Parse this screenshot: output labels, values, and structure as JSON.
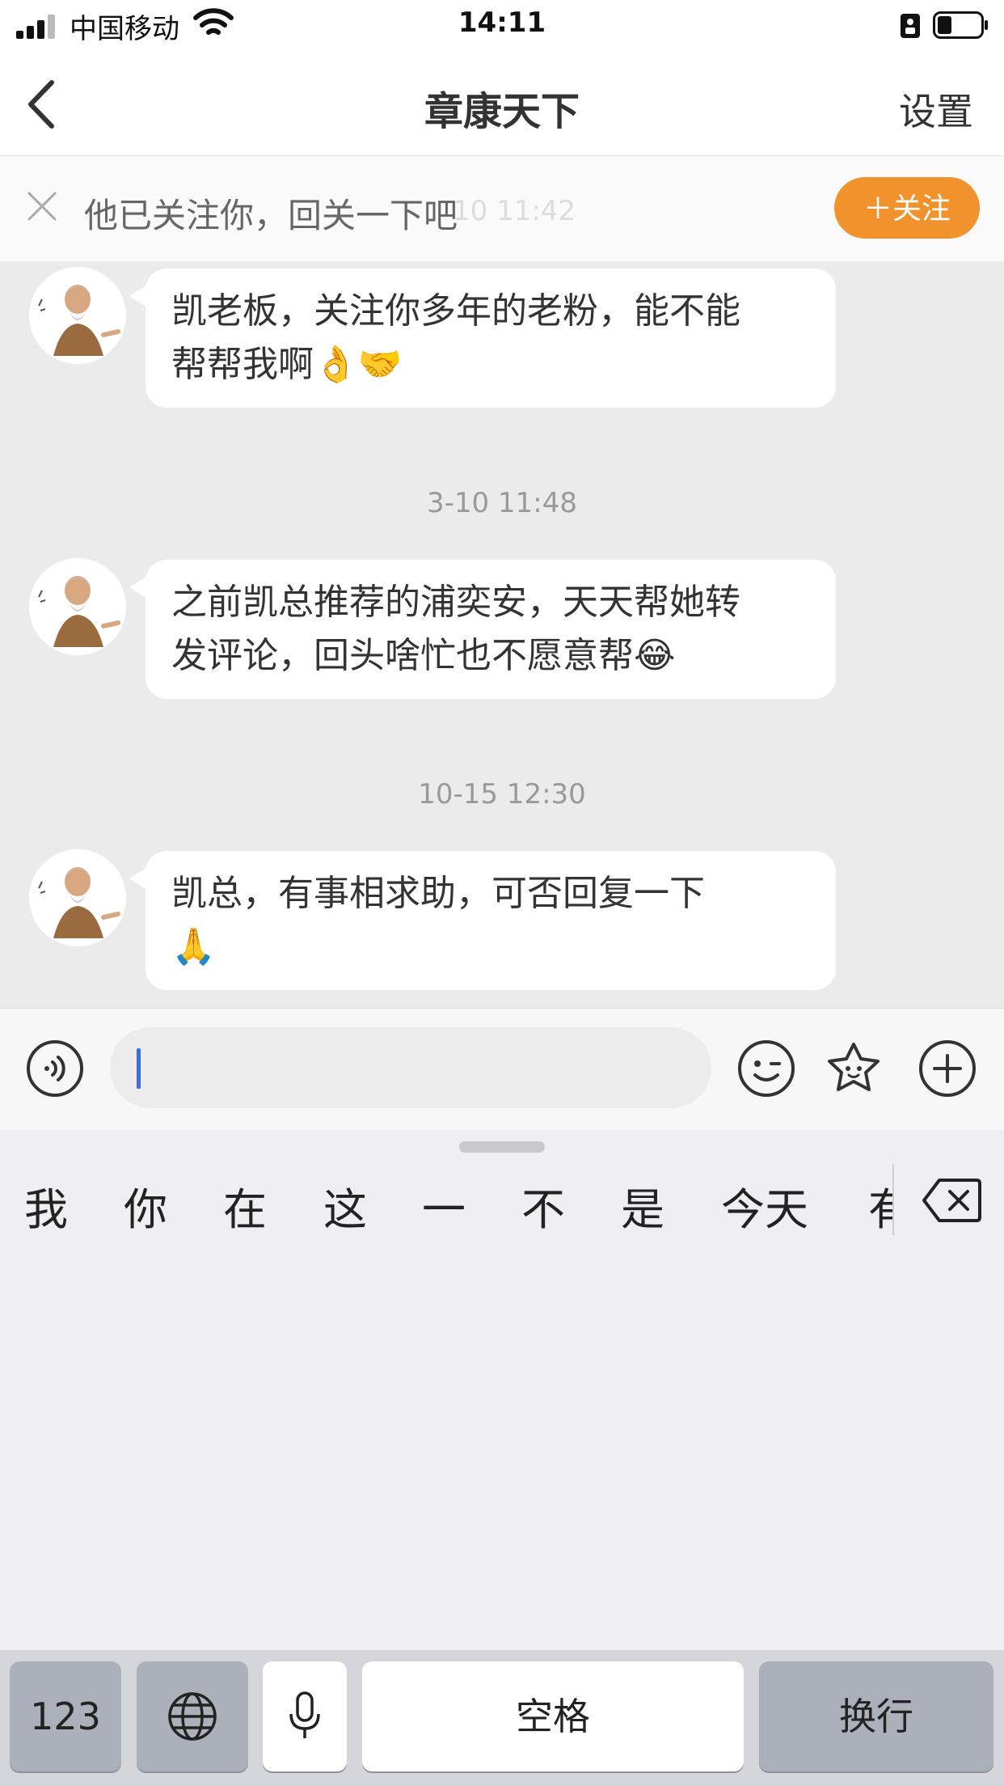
{
  "status": {
    "carrier": "中国移动",
    "time": "14:11"
  },
  "nav": {
    "title": "章康天下",
    "settings": "设置"
  },
  "banner": {
    "text": "他已关注你，回关一下吧",
    "ghost_timestamp": "10 11:42",
    "follow_label": "＋关注"
  },
  "messages": [
    {
      "lines": [
        "凯老板，关注你多年的老粉，能不能",
        "帮帮我啊👌🤝"
      ]
    },
    {
      "timestamp": "3-10 11:48",
      "lines": [
        "之前凯总推荐的浦奕安，天天帮她转",
        "发评论，回头啥忙也不愿意帮😂"
      ]
    },
    {
      "timestamp": "10-15 12:30",
      "lines": [
        "凯总，有事相求助，可否回复一下",
        "🙏"
      ]
    }
  ],
  "input": {
    "value": ""
  },
  "keyboard": {
    "candidates": [
      "我",
      "你",
      "在",
      "这",
      "一",
      "不",
      "是",
      "今天",
      "有"
    ],
    "keys": {
      "numbers": "123",
      "space": "空格",
      "return": "换行"
    }
  }
}
